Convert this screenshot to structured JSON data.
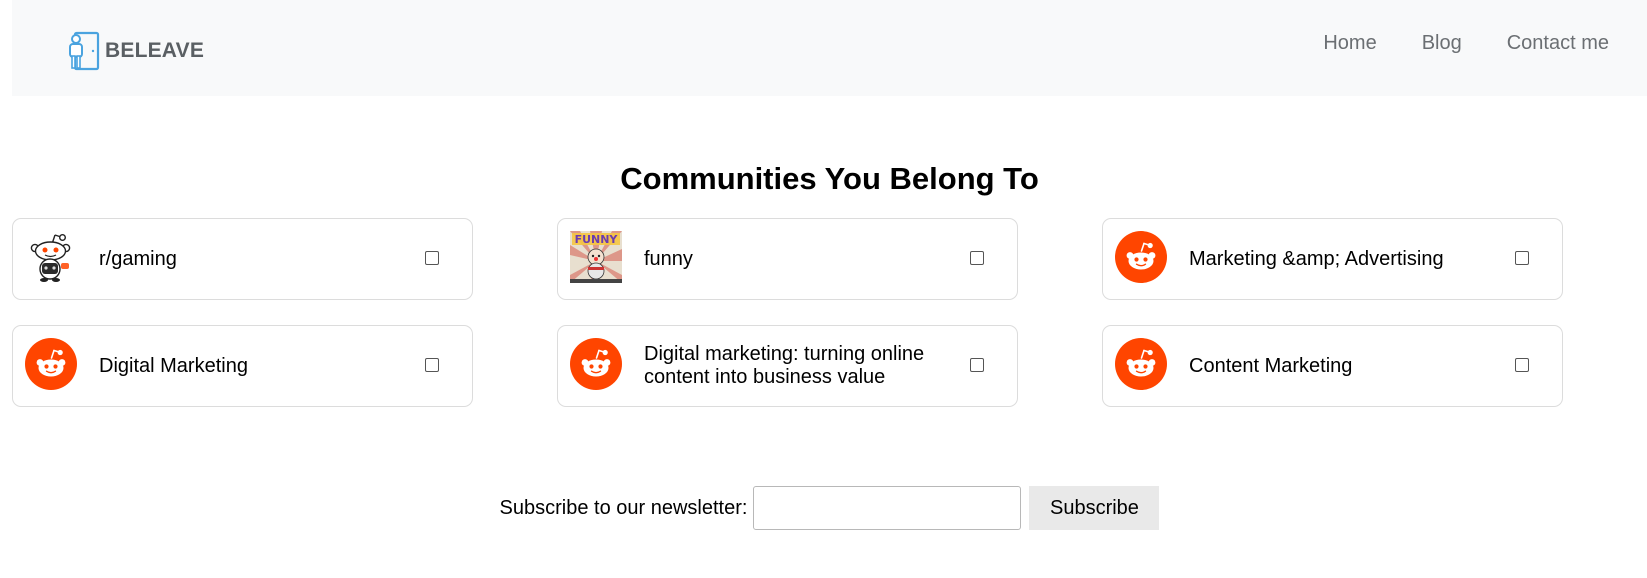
{
  "navbar": {
    "brand": "BELEAVE",
    "links": [
      "Home",
      "Blog",
      "Contact me"
    ]
  },
  "main": {
    "title": "Communities You Belong To",
    "communities": [
      {
        "name": "r/gaming",
        "icon": "reddit-snoo-gaming-icon",
        "checked": false
      },
      {
        "name": "funny",
        "icon": "funny-community-image",
        "checked": false
      },
      {
        "name": "Marketing &amp; Advertising",
        "icon": "reddit-logo-icon",
        "checked": false
      },
      {
        "name": "Digital Marketing",
        "icon": "reddit-logo-icon",
        "checked": false
      },
      {
        "name": "Digital marketing: turning online content into business value",
        "icon": "reddit-logo-icon",
        "checked": false
      },
      {
        "name": "Content Marketing",
        "icon": "reddit-logo-icon",
        "checked": false
      }
    ]
  },
  "newsletter": {
    "label": "Subscribe to our newsletter:",
    "input_value": "",
    "button_label": "Subscribe"
  },
  "colors": {
    "reddit_orange": "#ff4500",
    "brand_icon": "#4aa3df",
    "navbar_bg": "#f8f9fa"
  }
}
